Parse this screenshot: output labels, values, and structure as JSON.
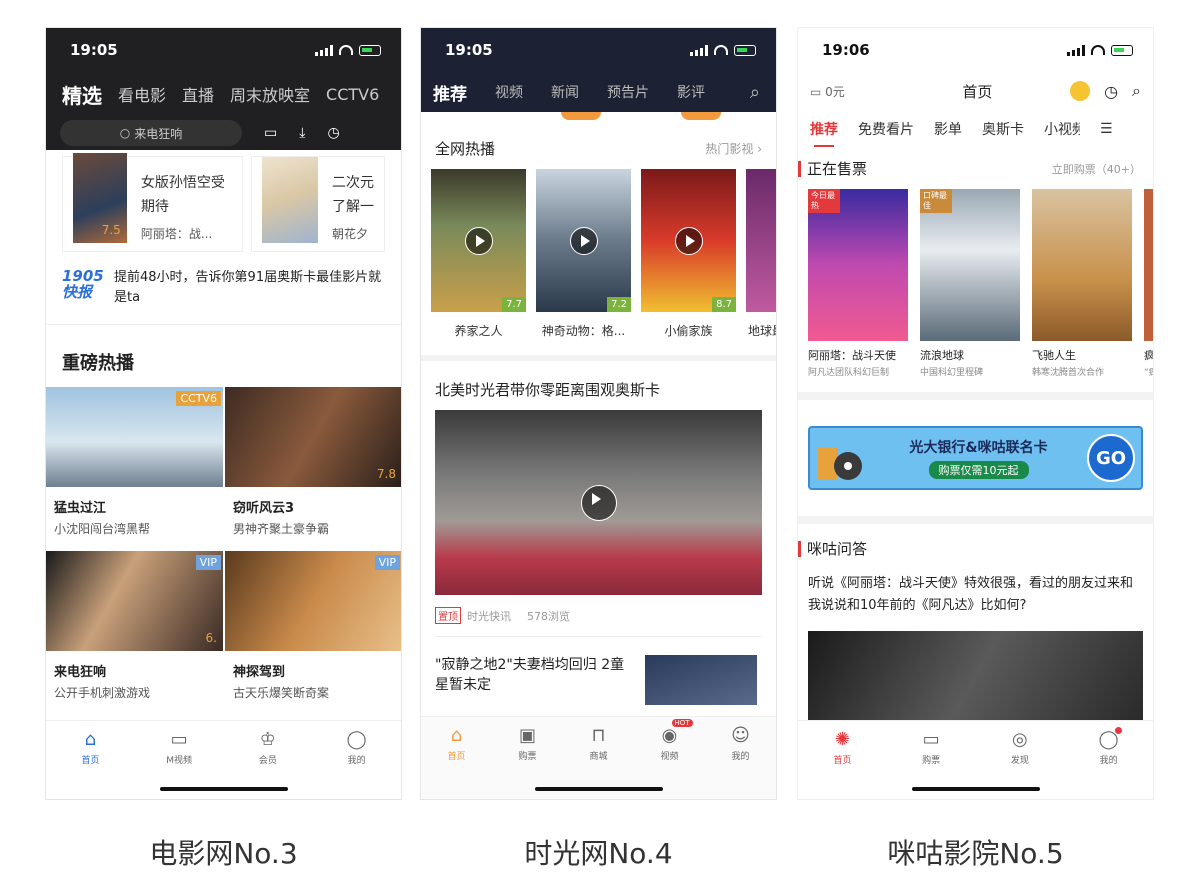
{
  "captions": [
    "电影网No.3",
    "时光网No.4",
    "咪咕影院No.5"
  ],
  "phone1": {
    "status_time": "19:05",
    "tabs": [
      "精选",
      "看电影",
      "直播",
      "周末放映室",
      "CCTV6"
    ],
    "search_placeholder": "来电狂响",
    "top_cards": [
      {
        "title": "女版孙悟空受期待",
        "sub": "阿丽塔：战...",
        "score": "7.5"
      },
      {
        "title": "二次元了解一",
        "sub": "朝花夕"
      }
    ],
    "news_logo": "1905快报",
    "news_text": "提前48小时，告诉你第91届奥斯卡最佳影片就是ta",
    "section_title": "重磅热播",
    "grid": [
      {
        "title": "猛虫过江",
        "sub": "小沈阳闯台湾黑帮",
        "badge": "CCTV6"
      },
      {
        "title": "窃听风云3",
        "sub": "男神齐聚土豪争霸",
        "score": "7.8"
      },
      {
        "title": "来电狂响",
        "sub": "公开手机刺激游戏",
        "badge": "VIP",
        "score": "6."
      },
      {
        "title": "神探驾到",
        "sub": "古天乐爆笑断奇案",
        "badge": "VIP"
      }
    ],
    "tabbar": [
      "首页",
      "M视频",
      "会员",
      "我的"
    ]
  },
  "phone2": {
    "status_time": "19:05",
    "tabs": [
      "推荐",
      "视频",
      "新闻",
      "预告片",
      "影评"
    ],
    "hot_title": "全网热播",
    "hot_more": "热门影视 ›",
    "posters": [
      {
        "title": "养家之人",
        "score": "7.7"
      },
      {
        "title": "神奇动物：格...",
        "score": "7.2"
      },
      {
        "title": "小偷家族",
        "score": "8.7"
      },
      {
        "title": "地球最"
      }
    ],
    "article_title": "北美时光君带你零距离围观奥斯卡",
    "article_tag": "置顶",
    "article_source": "时光快讯",
    "article_views": "578浏览",
    "second_article": "\"寂静之地2\"夫妻档均回归 2童星暂未定",
    "tabbar": [
      "首页",
      "购票",
      "商城",
      "视频",
      "我的"
    ],
    "hot_badge": "HOT"
  },
  "phone3": {
    "status_time": "19:06",
    "wallet": "0元",
    "title": "首页",
    "tabs": [
      "推荐",
      "免费看片",
      "影单",
      "奥斯卡",
      "小视频"
    ],
    "on_sale_title": "正在售票",
    "on_sale_more": "立即购票（40+）",
    "movies": [
      {
        "name": "阿丽塔：战斗天使",
        "desc": "阿凡达团队科幻巨制",
        "tag": "今日最热"
      },
      {
        "name": "流浪地球",
        "desc": "中国科幻里程碑",
        "tag": "口碑最佳"
      },
      {
        "name": "飞驰人生",
        "desc": "韩寒沈腾首次合作"
      },
      {
        "name": "疯",
        "desc": "“疯"
      }
    ],
    "banner_text": "光大银行&咪咕联名卡",
    "banner_sub": "购票仅需10元起",
    "banner_go": "GO",
    "qa_title": "咪咕问答",
    "qa_text": "听说《阿丽塔：战斗天使》特效很强，看过的朋友过来和我说说和10年前的《阿凡达》比如何?",
    "tabbar": [
      "首页",
      "购票",
      "发现",
      "我的"
    ],
    "colors": {
      "accent": "#e4393c"
    }
  }
}
